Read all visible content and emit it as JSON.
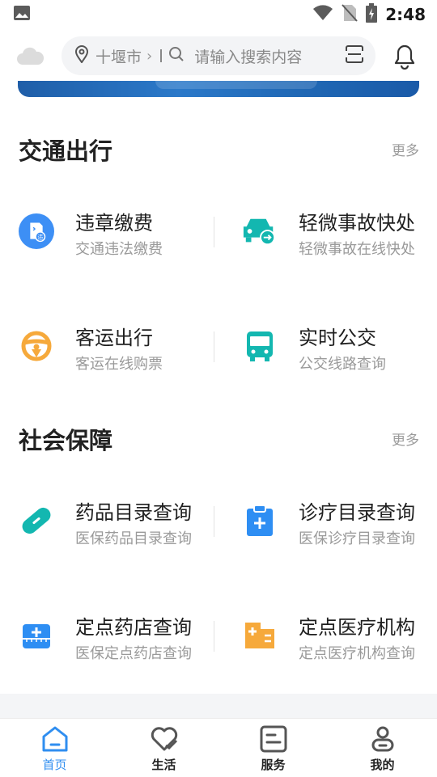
{
  "status_bar": {
    "time": "2:48"
  },
  "header": {
    "city": "十堰市",
    "search_placeholder": "请输入搜索内容"
  },
  "sections": [
    {
      "title": "交通出行",
      "more": "更多",
      "items": [
        {
          "title": "违章缴费",
          "subtitle": "交通违法缴费",
          "icon": "violation-payment-icon",
          "color": "#3d8ff5"
        },
        {
          "title": "轻微事故快处",
          "subtitle": "轻微事故在线快处",
          "icon": "car-accident-icon",
          "color": "#13b7b0"
        },
        {
          "title": "客运出行",
          "subtitle": "客运在线购票",
          "icon": "steering-wheel-icon",
          "color": "#f6a93b"
        },
        {
          "title": "实时公交",
          "subtitle": "公交线路查询",
          "icon": "bus-icon",
          "color": "#13b7b0"
        }
      ]
    },
    {
      "title": "社会保障",
      "more": "更多",
      "items": [
        {
          "title": "药品目录查询",
          "subtitle": "医保药品目录查询",
          "icon": "pill-icon",
          "color": "#13b7b0"
        },
        {
          "title": "诊疗目录查询",
          "subtitle": "医保诊疗目录查询",
          "icon": "clipboard-medical-icon",
          "color": "#2e8ef3"
        },
        {
          "title": "定点药店查询",
          "subtitle": "医保定点药店查询",
          "icon": "medical-kit-icon",
          "color": "#2e8ef3"
        },
        {
          "title": "定点医疗机构",
          "subtitle": "定点医疗机构查询",
          "icon": "hospital-building-icon",
          "color": "#f6a93b"
        }
      ]
    }
  ],
  "tabbar": {
    "active_color": "#2f8ef0",
    "tabs": [
      {
        "label": "首页",
        "icon": "home-icon"
      },
      {
        "label": "生活",
        "icon": "heart-check-icon"
      },
      {
        "label": "服务",
        "icon": "service-doc-icon"
      },
      {
        "label": "我的",
        "icon": "profile-icon"
      }
    ]
  }
}
